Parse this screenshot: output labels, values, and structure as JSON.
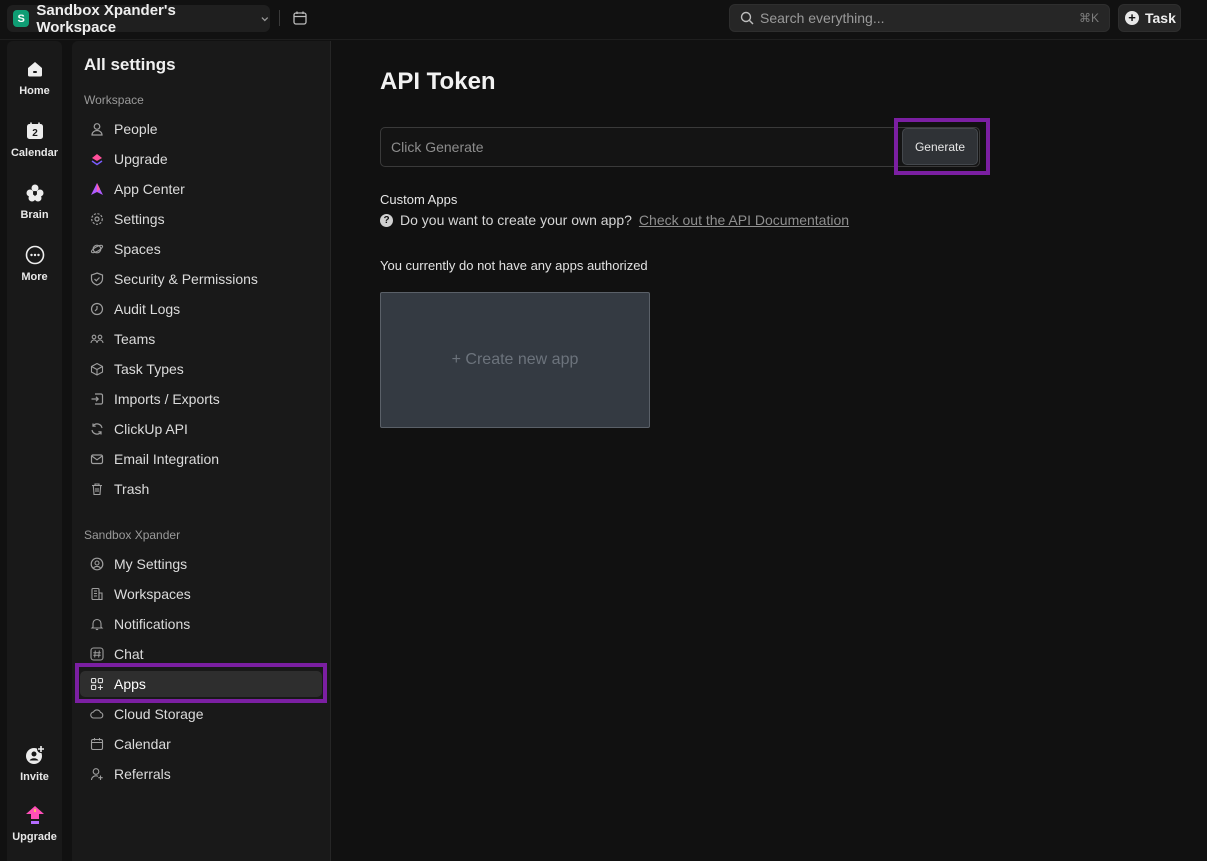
{
  "topbar": {
    "workspace_initial": "S",
    "workspace_name": "Sandbox Xpander's Workspace",
    "search_placeholder": "Search everything...",
    "search_shortcut": "⌘K",
    "task_label": "Task"
  },
  "rail": {
    "items": [
      {
        "label": "Home",
        "icon": "home-icon"
      },
      {
        "label": "Calendar",
        "icon": "calendar-icon",
        "badge": "2"
      },
      {
        "label": "Brain",
        "icon": "brain-icon"
      },
      {
        "label": "More",
        "icon": "more-icon"
      }
    ],
    "bottom": [
      {
        "label": "Invite",
        "icon": "invite-icon"
      },
      {
        "label": "Upgrade",
        "icon": "upgrade-icon"
      }
    ]
  },
  "sidebar": {
    "title": "All settings",
    "workspace_section": "Workspace",
    "workspace_items": [
      {
        "label": "People",
        "icon": "person-icon"
      },
      {
        "label": "Upgrade",
        "icon": "upgrade-icon"
      },
      {
        "label": "App Center",
        "icon": "app-center-icon"
      },
      {
        "label": "Settings",
        "icon": "gear-icon"
      },
      {
        "label": "Spaces",
        "icon": "planet-icon"
      },
      {
        "label": "Security & Permissions",
        "icon": "shield-icon"
      },
      {
        "label": "Audit Logs",
        "icon": "clock-icon"
      },
      {
        "label": "Teams",
        "icon": "teams-icon"
      },
      {
        "label": "Task Types",
        "icon": "cube-icon"
      },
      {
        "label": "Imports / Exports",
        "icon": "import-icon"
      },
      {
        "label": "ClickUp API",
        "icon": "refresh-icon"
      },
      {
        "label": "Email Integration",
        "icon": "mail-icon"
      },
      {
        "label": "Trash",
        "icon": "trash-icon"
      }
    ],
    "user_section": "Sandbox Xpander",
    "user_items": [
      {
        "label": "My Settings",
        "icon": "user-circle-icon"
      },
      {
        "label": "Workspaces",
        "icon": "building-icon"
      },
      {
        "label": "Notifications",
        "icon": "bell-icon"
      },
      {
        "label": "Chat",
        "icon": "hash-icon"
      },
      {
        "label": "Apps",
        "icon": "apps-icon",
        "active": true
      },
      {
        "label": "Cloud Storage",
        "icon": "cloud-icon"
      },
      {
        "label": "Calendar",
        "icon": "calendar-icon"
      },
      {
        "label": "Referrals",
        "icon": "referral-icon"
      }
    ]
  },
  "main": {
    "title": "API Token",
    "token_placeholder": "Click Generate",
    "generate_label": "Generate",
    "custom_apps_title": "Custom Apps",
    "custom_apps_question": "Do you want to create your own app?",
    "custom_apps_link": "Check out the API Documentation",
    "no_apps_text": "You currently do not have any apps authorized",
    "create_app_label": "+ Create new app"
  },
  "colors": {
    "highlight": "#7b1fa2",
    "workspace_avatar": "#0f9d74"
  }
}
